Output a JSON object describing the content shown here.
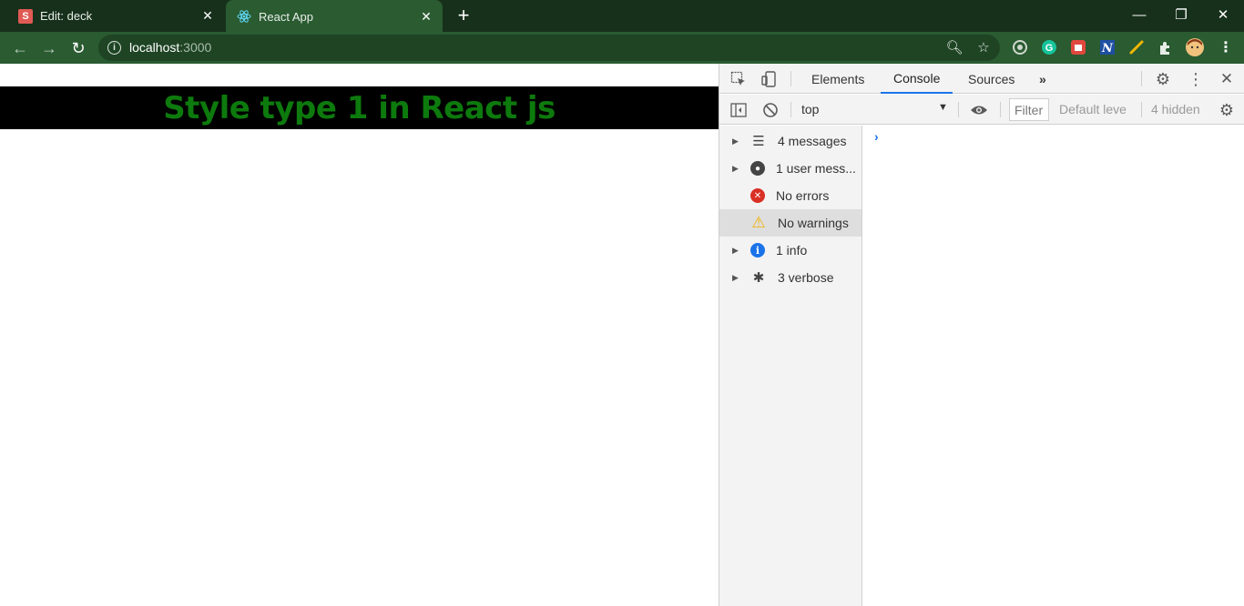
{
  "browser": {
    "tabs": [
      {
        "title": "Edit: deck",
        "favicon": "S"
      },
      {
        "title": "React App",
        "favicon": "react-icon"
      }
    ],
    "url_host": "localhost",
    "url_port": ":3000"
  },
  "page": {
    "heading": "Style type 1 in React js",
    "heading_color": "#0d7a0d",
    "banner_color": "#000000"
  },
  "devtools": {
    "tabs": [
      "Elements",
      "Console",
      "Sources"
    ],
    "active_tab": "Console",
    "context": "top",
    "filter_placeholder": "Filter",
    "levels": "Default leve",
    "hidden": "4 hidden",
    "sidebar": [
      {
        "label": "4 messages",
        "icon": "list-icon"
      },
      {
        "label": "1 user mess...",
        "icon": "user-icon"
      },
      {
        "label": "No errors",
        "icon": "error-icon"
      },
      {
        "label": "No warnings",
        "icon": "warning-icon",
        "selected": true
      },
      {
        "label": "1 info",
        "icon": "info-icon"
      },
      {
        "label": "3 verbose",
        "icon": "bug-icon"
      }
    ],
    "prompt": "›"
  }
}
